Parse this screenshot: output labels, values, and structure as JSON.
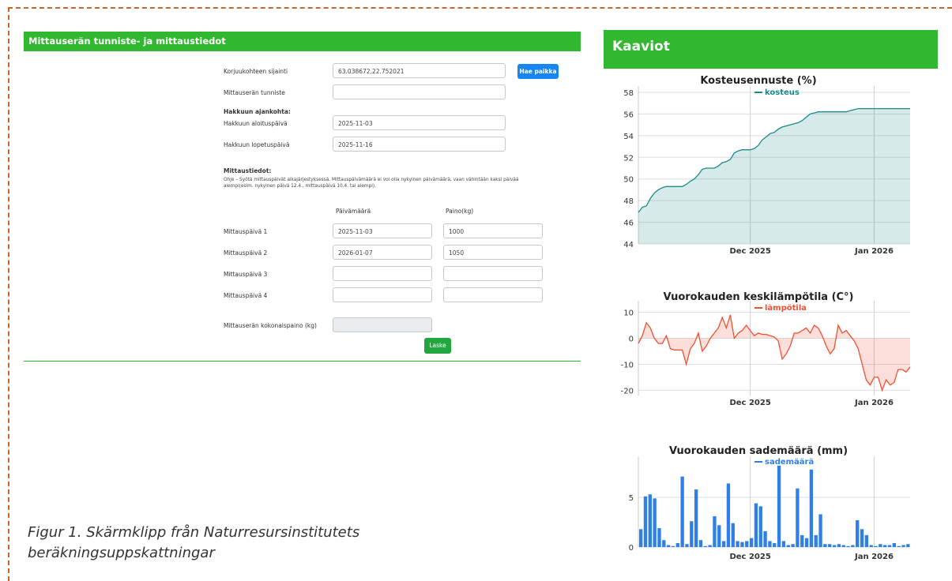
{
  "form": {
    "title": "Mittauserän tunniste- ja mittaustiedot",
    "location_label": "Korjuukohteen sijainti",
    "location_value": "63.038672,22.752021",
    "find_button": "Hae paikka",
    "batch_id_label": "Mittauserän tunniste",
    "harvest_heading": "Hakkuun ajankohta:",
    "harvest_start_label": "Hakkuun aloituspäivä",
    "harvest_start_value": "2025-11-03",
    "harvest_end_label": "Hakkuun lopetuspäivä",
    "harvest_end_value": "2025-11-16",
    "measure_heading": "Mittaustiedot:",
    "measure_note": "Ohje – Syötä mittauspäivät aikajärjestyksessä. Mittauspäivämäärä ei voi olla nykyinen päivämäärä, vaan vähintään kaksi päivää aiempi(esim. nykyinen päivä 12.4., mittauspäivä 10.4. tai aiempi).",
    "col_date": "Päivämäärä",
    "col_weight": "Paino(kg)",
    "rows": [
      {
        "label": "Mittauspäivä 1",
        "date": "2025-11-03",
        "weight": "1000"
      },
      {
        "label": "Mittauspäivä 2",
        "date": "2026-01-07",
        "weight": "1050"
      },
      {
        "label": "Mittauspäivä 3",
        "date": "",
        "weight": ""
      },
      {
        "label": "Mittauspäivä 4",
        "date": "",
        "weight": ""
      }
    ],
    "total_label": "Mittauserän kokonaispaino (kg)",
    "calc_button": "Laske"
  },
  "caption": "Figur 1. Skärmklipp från Naturresursinstitutets beräkningsuppskattningar",
  "charts_header": "Kaaviot",
  "colors": {
    "green": "#32b830",
    "moisture": "#1a8a8a",
    "temperature": "#f05030",
    "rain": "#2f7fe8",
    "border": "#c9642a"
  },
  "chart_data": [
    {
      "type": "area",
      "title": "Kosteusennuste (%)",
      "legend": "kosteus",
      "x_ticks": [
        "Dec 2025",
        "Jan 2026"
      ],
      "y_ticks": [
        44,
        46,
        48,
        50,
        52,
        54,
        56,
        58
      ],
      "ylim": [
        44,
        58
      ],
      "x_start": "2025-11-03",
      "x_end": "2026-01-10",
      "values": [
        46.9,
        47.4,
        47.5,
        48.2,
        48.7,
        49.0,
        49.2,
        49.3,
        49.3,
        49.3,
        49.3,
        49.3,
        49.5,
        49.8,
        50.0,
        50.4,
        50.9,
        51.0,
        51.0,
        51.0,
        51.2,
        51.5,
        51.6,
        51.8,
        52.4,
        52.6,
        52.7,
        52.7,
        52.7,
        52.8,
        53.1,
        53.6,
        53.9,
        54.2,
        54.3,
        54.6,
        54.8,
        54.9,
        55.0,
        55.1,
        55.2,
        55.4,
        55.7,
        56.0,
        56.1,
        56.2,
        56.2,
        56.2,
        56.2,
        56.2,
        56.2,
        56.2,
        56.2,
        56.3,
        56.4,
        56.5,
        56.5,
        56.5,
        56.5,
        56.5,
        56.5,
        56.5,
        56.5,
        56.5,
        56.5,
        56.5,
        56.5,
        56.5,
        56.5
      ]
    },
    {
      "type": "area",
      "title": "Vuorokauden keskilämpötila (C°)",
      "legend": "lämpötila",
      "x_ticks": [
        "Dec 2025",
        "Jan 2026"
      ],
      "y_ticks": [
        -20,
        -10,
        0,
        10
      ],
      "ylim": [
        -22,
        12
      ],
      "x_start": "2025-11-03",
      "x_end": "2026-01-10",
      "values": [
        -2,
        1,
        6,
        4,
        0,
        -2,
        -2,
        1,
        -4,
        -4.5,
        -4.5,
        -4.5,
        -10,
        -4,
        -2,
        2,
        -5,
        -3,
        0,
        2,
        4,
        8,
        4,
        9,
        0,
        2,
        3,
        5,
        3,
        1,
        2,
        1.5,
        1.5,
        1,
        0.5,
        -1,
        -8,
        -6,
        -3,
        2,
        2,
        3,
        4,
        2,
        5,
        4,
        1,
        -3,
        -6,
        -4,
        5,
        2,
        3,
        1,
        -1,
        -4,
        -10,
        -16,
        -18,
        -15,
        -15,
        -20,
        -16,
        -18,
        -17,
        -12,
        -12,
        -13,
        -11
      ]
    },
    {
      "type": "bar",
      "title": "Vuorokauden sademäärä (mm)",
      "legend": "sademäärä",
      "x_ticks": [
        "Dec 2025",
        "Jan 2026"
      ],
      "y_ticks": [
        0,
        5
      ],
      "ylim": [
        0,
        8.5
      ],
      "x_start": "2025-11-03",
      "x_end": "2026-01-10",
      "values": [
        1.8,
        5.1,
        5.3,
        4.9,
        1.9,
        0.7,
        0.2,
        0.1,
        0.4,
        7.1,
        0.3,
        2.6,
        5.8,
        0.7,
        0.1,
        0.2,
        3.1,
        2.2,
        0.6,
        6.4,
        2.4,
        0.6,
        0.5,
        0.6,
        0.9,
        4.4,
        4.1,
        1.6,
        0.6,
        0.4,
        8.2,
        0.6,
        0.2,
        0.3,
        5.9,
        1.2,
        0.9,
        7.8,
        1.2,
        3.3,
        0.3,
        0.3,
        0.2,
        0.3,
        0.2,
        0.1,
        0.2,
        2.7,
        1.8,
        1.2,
        0.2,
        0.1,
        0.3,
        0.2,
        0.2,
        0.4,
        0.1,
        0.2,
        0.3
      ]
    }
  ]
}
